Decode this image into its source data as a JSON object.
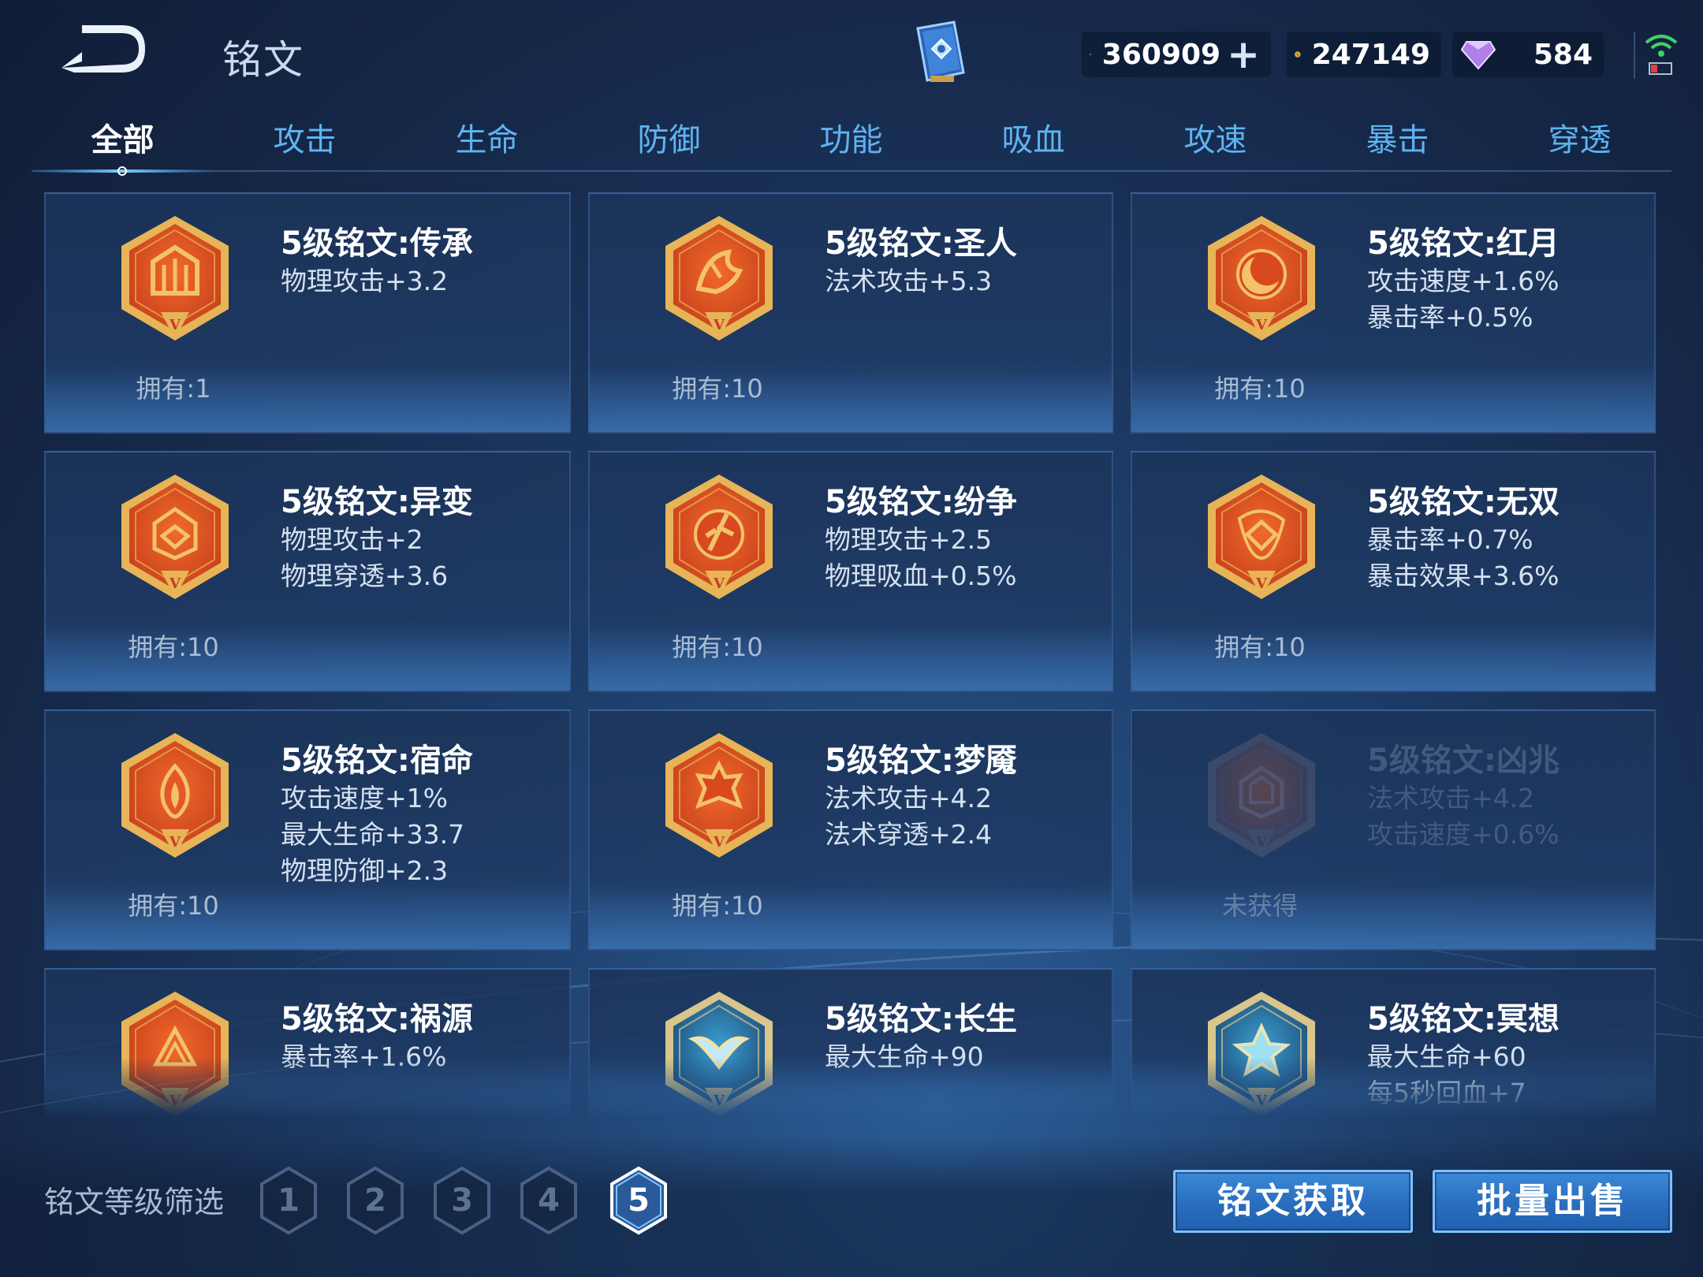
{
  "header": {
    "title": "铭文",
    "currencies": {
      "gem": "360909",
      "coin": "247149",
      "diamond": "584"
    }
  },
  "tabs": [
    "全部",
    "攻击",
    "生命",
    "防御",
    "功能",
    "吸血",
    "攻速",
    "暴击",
    "穿透"
  ],
  "active_tab": "全部",
  "colors": {
    "accent": "#5fb3f0",
    "button": "#2a6fc0",
    "emblem_red": "#c8401c",
    "emblem_gold": "#e7b457",
    "emblem_teal": "#4bb6d6"
  },
  "runes": [
    {
      "name": "5级铭文:传承",
      "stats": [
        "物理攻击+3.2"
      ],
      "owned": "拥有:1",
      "icon": "rune-inheritance-icon"
    },
    {
      "name": "5级铭文:圣人",
      "stats": [
        "法术攻击+5.3"
      ],
      "owned": "拥有:10",
      "icon": "rune-sage-icon"
    },
    {
      "name": "5级铭文:红月",
      "stats": [
        "攻击速度+1.6%",
        "暴击率+0.5%"
      ],
      "owned": "拥有:10",
      "icon": "rune-red-moon-icon"
    },
    {
      "name": "5级铭文:异变",
      "stats": [
        "物理攻击+2",
        "物理穿透+3.6"
      ],
      "owned": "拥有:10",
      "icon": "rune-mutation-icon"
    },
    {
      "name": "5级铭文:纷争",
      "stats": [
        "物理攻击+2.5",
        "物理吸血+0.5%"
      ],
      "owned": "拥有:10",
      "icon": "rune-discord-icon"
    },
    {
      "name": "5级铭文:无双",
      "stats": [
        "暴击率+0.7%",
        "暴击效果+3.6%"
      ],
      "owned": "拥有:10",
      "icon": "rune-peerless-icon"
    },
    {
      "name": "5级铭文:宿命",
      "stats": [
        "攻击速度+1%",
        "最大生命+33.7",
        "物理防御+2.3"
      ],
      "owned": "拥有:10",
      "icon": "rune-fate-icon"
    },
    {
      "name": "5级铭文:梦魇",
      "stats": [
        "法术攻击+4.2",
        "法术穿透+2.4"
      ],
      "owned": "拥有:10",
      "icon": "rune-nightmare-icon"
    },
    {
      "name": "5级铭文:凶兆",
      "stats": [
        "法术攻击+4.2",
        "攻击速度+0.6%"
      ],
      "owned": "未获得",
      "icon": "rune-omen-icon",
      "locked": true
    },
    {
      "name": "5级铭文:祸源",
      "stats": [
        "暴击率+1.6%"
      ],
      "owned": "",
      "icon": "rune-calamity-icon"
    },
    {
      "name": "5级铭文:长生",
      "stats": [
        "最大生命+90"
      ],
      "owned": "",
      "icon": "rune-longevity-icon"
    },
    {
      "name": "5级铭文:冥想",
      "stats": [
        "最大生命+60",
        "每5秒回血+7"
      ],
      "owned": "",
      "icon": "rune-meditation-icon"
    }
  ],
  "footer": {
    "filter_label": "铭文等级筛选",
    "levels": [
      "1",
      "2",
      "3",
      "4",
      "5"
    ],
    "active_level": "5",
    "acquire_label": "铭文获取",
    "sell_label": "批量出售"
  }
}
